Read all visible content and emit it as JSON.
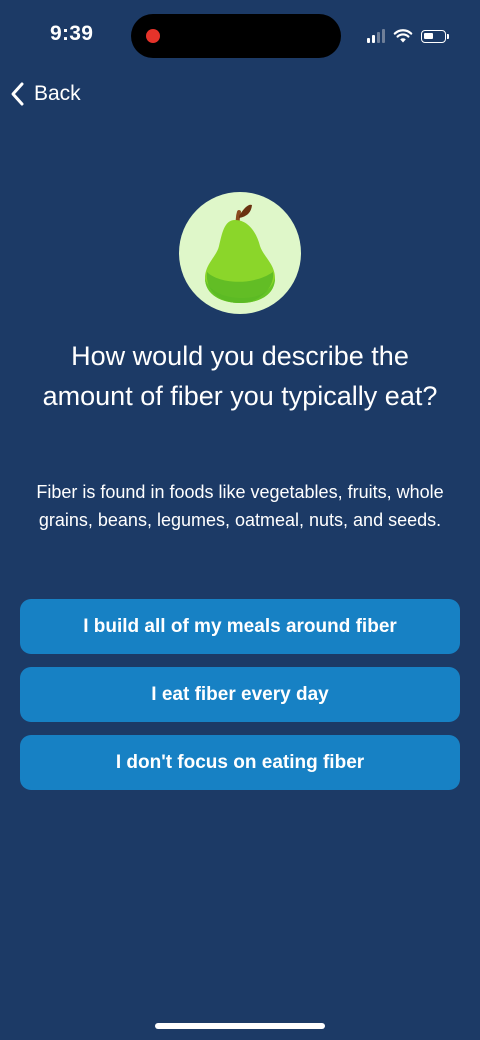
{
  "status_bar": {
    "time": "9:39",
    "recording_indicator_color": "#e5332a",
    "icons": [
      "signal-icon",
      "wifi-icon",
      "battery-icon"
    ]
  },
  "nav": {
    "back_label": "Back",
    "back_icon": "chevron-left-icon"
  },
  "hero": {
    "icon": "pear-icon",
    "background_color": "#dff7c9"
  },
  "question": {
    "title": "How would you describe the amount of fiber you typically eat?",
    "subtitle": "Fiber is found in foods like vegetables, fruits, whole grains, beans, legumes, oatmeal, nuts, and seeds."
  },
  "options": [
    {
      "label": "I build all of my meals around fiber"
    },
    {
      "label": "I eat fiber every day"
    },
    {
      "label": "I don't focus on eating fiber"
    }
  ],
  "colors": {
    "background": "#1c3a66",
    "button": "#1781c4",
    "text": "#ffffff"
  }
}
